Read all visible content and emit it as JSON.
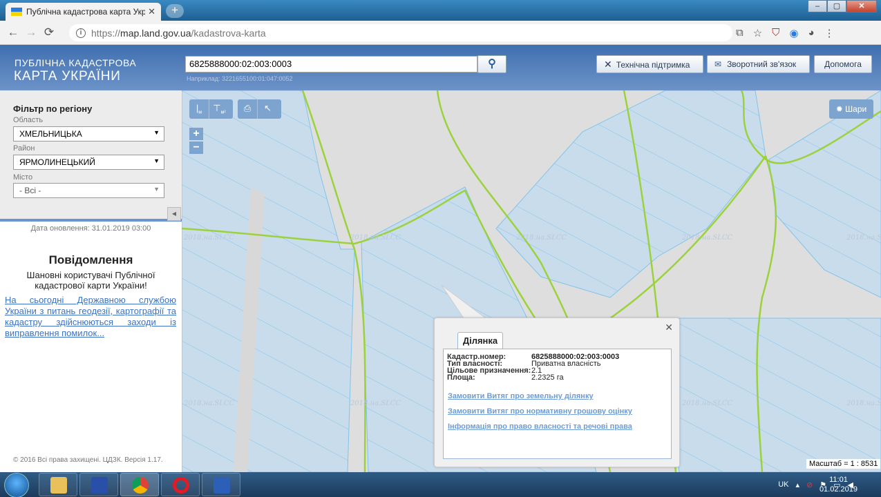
{
  "browser": {
    "tab_title": "Публічна кадастрова карта Укр",
    "url_prefix": "https://",
    "url_host": "map.land.gov.ua",
    "url_path": "/kadastrova-karta"
  },
  "header": {
    "logo_line1": "ПУБЛІЧНА КАДАСТРОВА",
    "logo_line2": "КАРТА УКРАЇНИ",
    "search_value": "6825888000:02:003:0003",
    "search_example": "Наприклад: 3221655100:01:047:0052",
    "support_label": "Технічна підтримка",
    "feedback_label": "Зворотний зв'язок",
    "help_label": "Допомога"
  },
  "filter": {
    "title": "Фільтр по регіону",
    "oblast_label": "Область",
    "oblast_value": "ХМЕЛЬНИЦЬКА",
    "rayon_label": "Район",
    "rayon_value": "ЯРМОЛИНЕЦЬКИЙ",
    "city_label": "Місто",
    "city_value": "- Всі -"
  },
  "sidebar": {
    "updated": "Дата оновлення: 31.01.2019 03:00",
    "news_title": "Повідомлення",
    "news_body": "Шановні користувачі Публічної кадастрової карти України!",
    "news_link": "На сьогодні Державною службою України з питань геодезії, картографії та кадастру здійснюються заходи із виправлення помилок...",
    "copyright": "© 2016 Всі права захищені. ЦДЗК. Версія 1.17."
  },
  "map": {
    "tools": [
      "м",
      "м²",
      "print",
      "?"
    ],
    "zoom_in": "+",
    "zoom_out": "−",
    "layers_label": "Шари",
    "watermark": "2018.на.SLCC",
    "scale": "Масштаб = 1 : 8531"
  },
  "popup": {
    "tab": "Ділянка",
    "rows": [
      {
        "k": "Кадастр.номер:",
        "v": "6825888000:02:003:0003"
      },
      {
        "k": "Тип власності:",
        "v": "Приватна власність"
      },
      {
        "k": "Цільове призначення:",
        "v": "2.1"
      },
      {
        "k": "Площа:",
        "v": "2.2325 га"
      }
    ],
    "link1": "Замовити Витяг про земельну ділянку",
    "link2": "Замовити Витяг про нормативну грошову оцінку",
    "link3": "Інформація про право власності та речові права"
  },
  "taskbar": {
    "lang": "UK",
    "time": "11:01",
    "date": "01.02.2019"
  },
  "colors": {
    "parcel": "#c9dcec",
    "parcel_line": "#7fc3ea",
    "boundary": "#9bd23b"
  }
}
